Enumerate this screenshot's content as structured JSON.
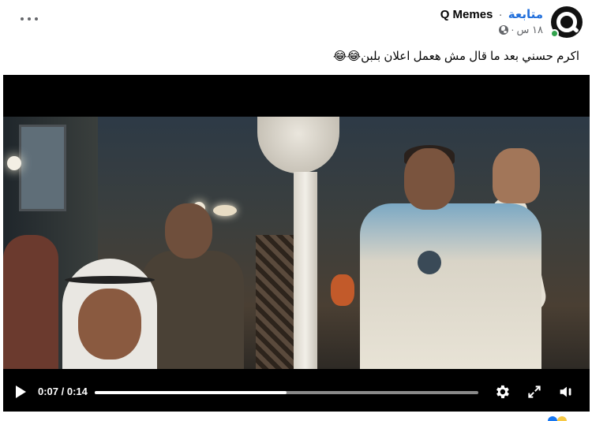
{
  "post": {
    "page_name": "Q Memes",
    "follow_label": "متابعة",
    "separator": "·",
    "time": "١٨ س",
    "time_separator": "·",
    "caption": "اكرم حسني بعد ما قال مش هعمل اعلان بلبن😂😂"
  },
  "icons": {
    "avatar": "q-logo-icon",
    "privacy": "globe-icon",
    "more": "more-options-icon",
    "play": "play-icon",
    "settings": "gear-icon",
    "fullscreen": "expand-icon",
    "volume": "volume-icon"
  },
  "video": {
    "time_display": "0:07 / 0:14",
    "progress_fraction": 0.5
  },
  "colors": {
    "follow": "#216fdb",
    "online": "#31a24c",
    "meta_text": "#65676b"
  }
}
